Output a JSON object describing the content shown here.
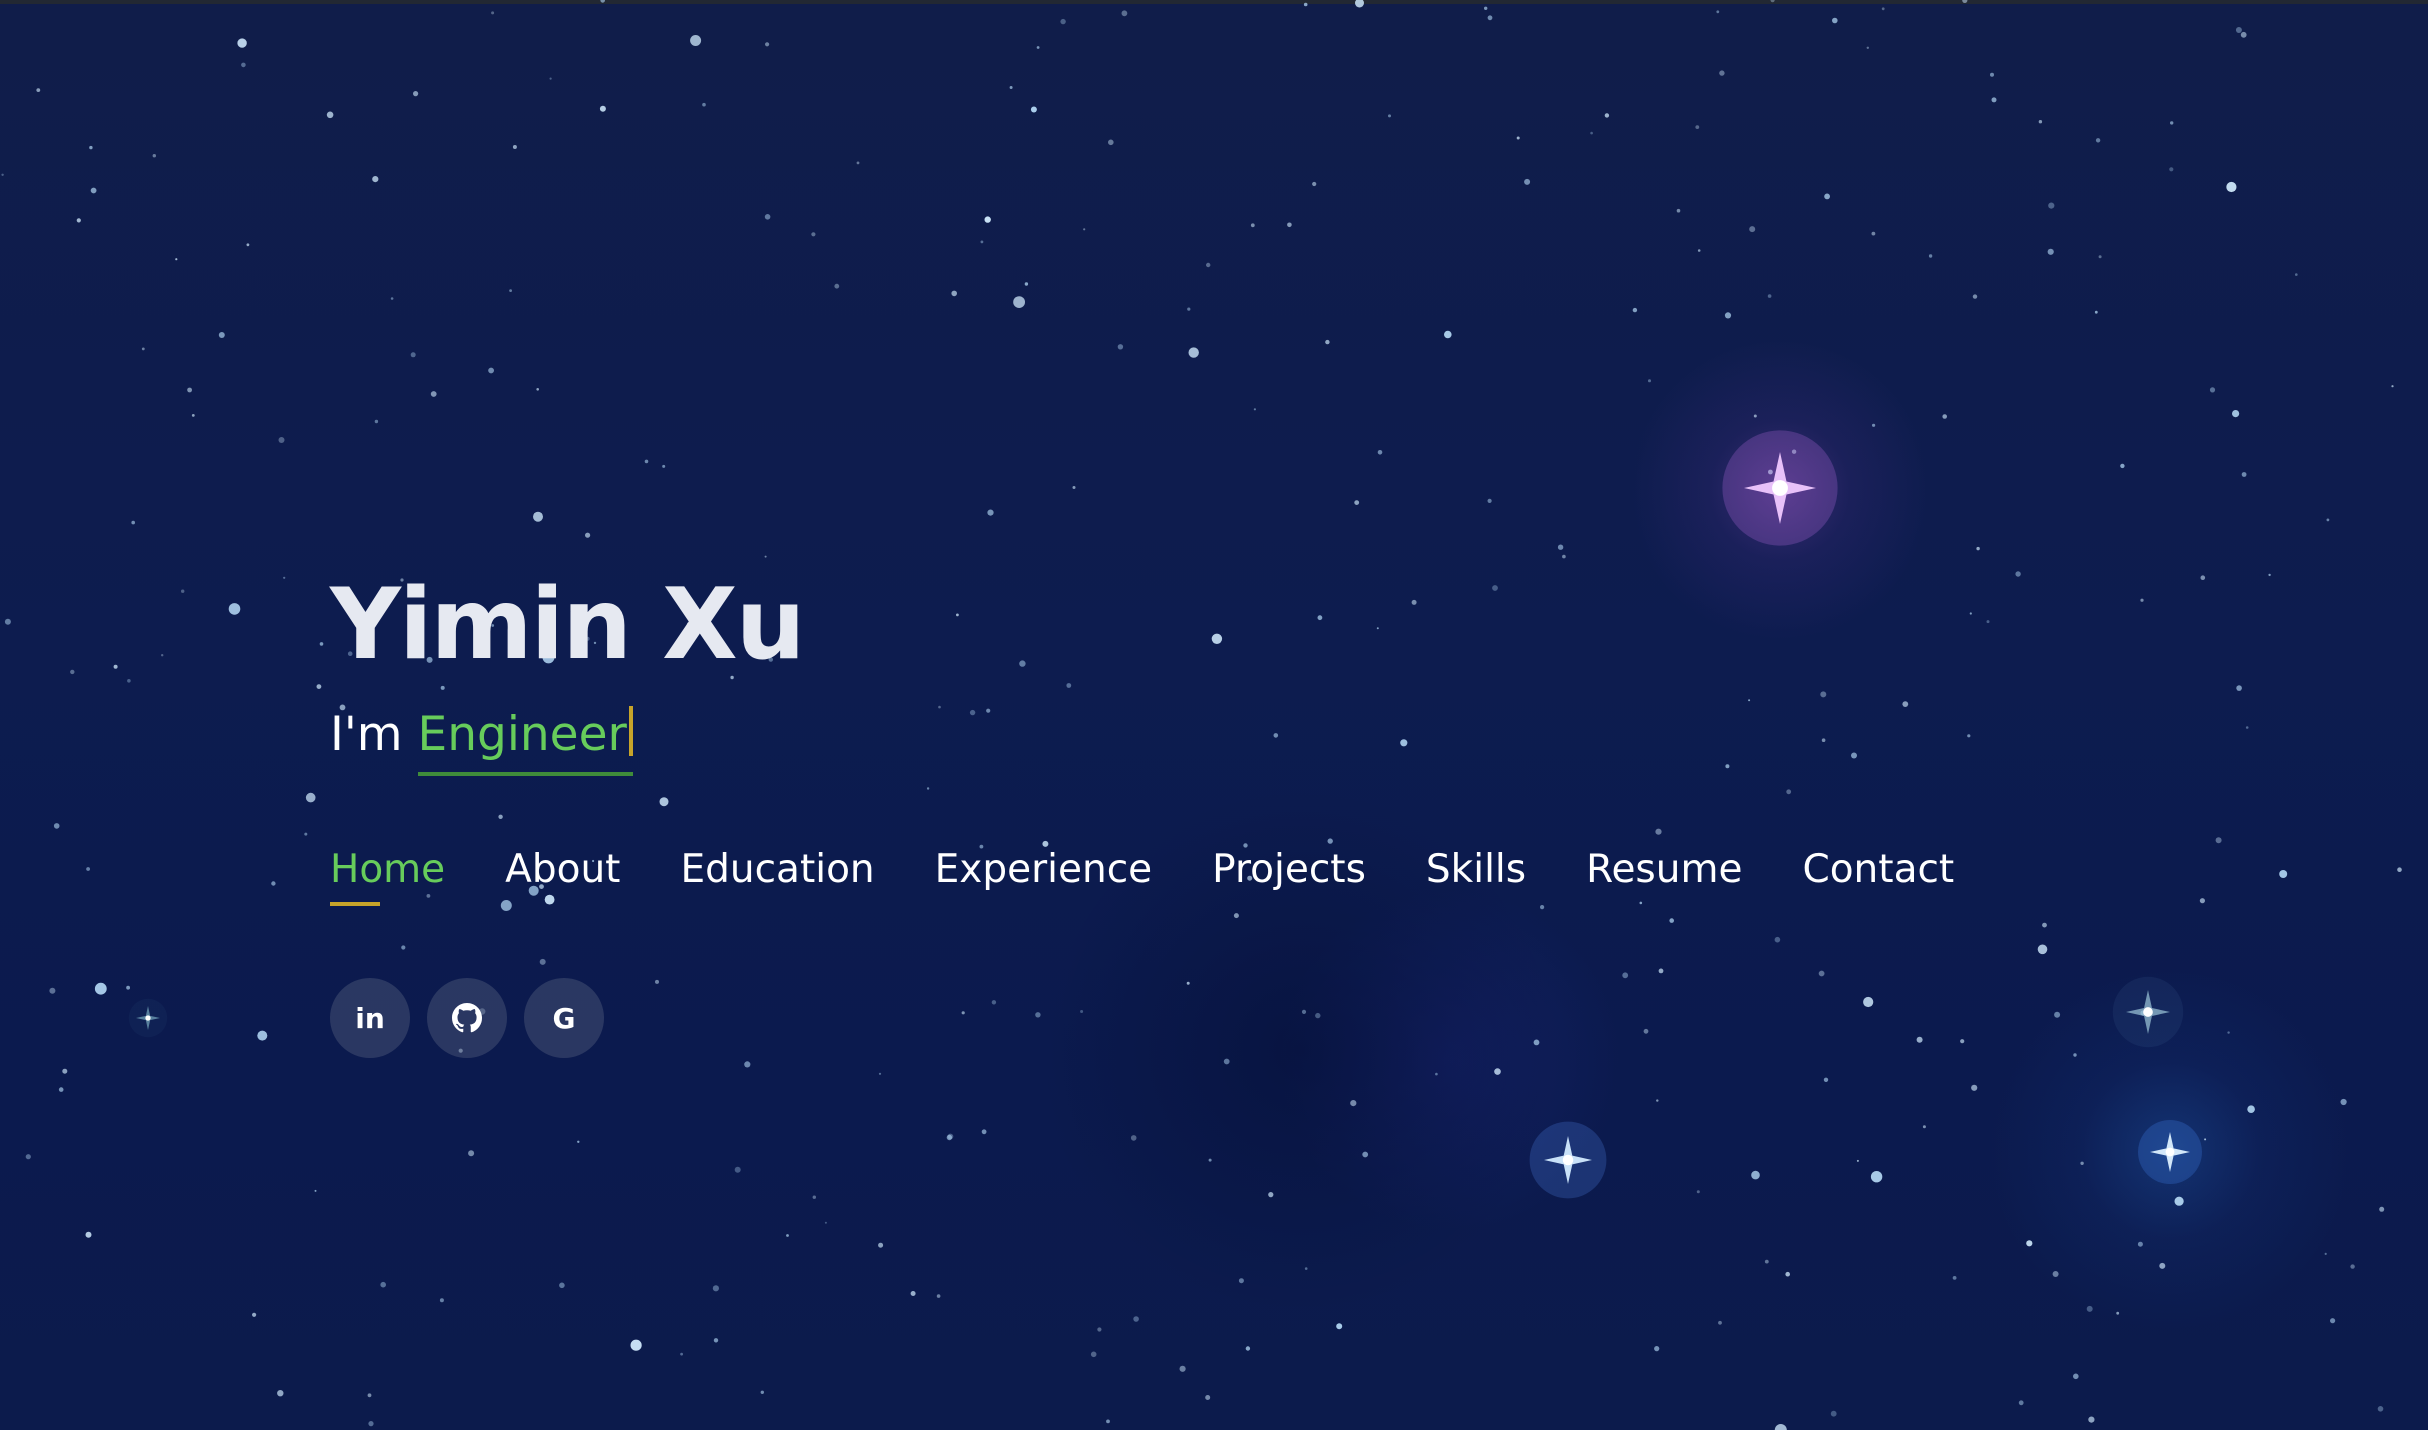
{
  "hero": {
    "name": "Yimin Xu",
    "tagline_prefix": "I'm ",
    "typed_word": "Engineer"
  },
  "nav": {
    "items": [
      {
        "label": "Home",
        "active": true
      },
      {
        "label": "About",
        "active": false
      },
      {
        "label": "Education",
        "active": false
      },
      {
        "label": "Experience",
        "active": false
      },
      {
        "label": "Projects",
        "active": false
      },
      {
        "label": "Skills",
        "active": false
      },
      {
        "label": "Resume",
        "active": false
      },
      {
        "label": "Contact",
        "active": false
      }
    ]
  },
  "social": {
    "links": [
      {
        "icon": "linkedin-icon",
        "glyph": "in"
      },
      {
        "icon": "github-icon",
        "glyph": ""
      },
      {
        "icon": "google-icon",
        "glyph": "G"
      }
    ]
  },
  "colors": {
    "background": "#0f1c4d",
    "accent_green": "#67cc5b",
    "accent_gold": "#c7a42a",
    "text": "#ffffff"
  }
}
